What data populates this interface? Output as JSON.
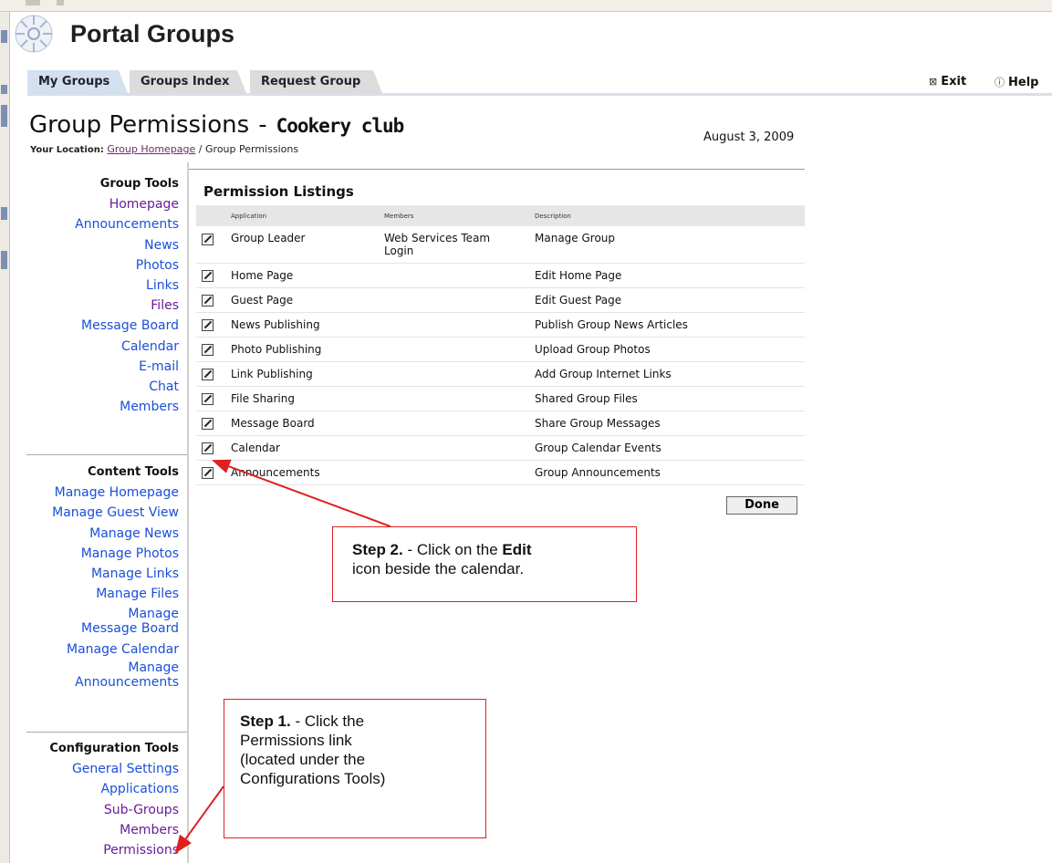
{
  "app": {
    "title": "Portal Groups"
  },
  "tabs": [
    {
      "label": "My Groups"
    },
    {
      "label": "Groups Index"
    },
    {
      "label": "Request Group"
    }
  ],
  "top_links": {
    "exit": "Exit",
    "help": "Help"
  },
  "page": {
    "title": "Group Permissions",
    "separator": "-",
    "group_name": "Cookery club",
    "location_label": "Your Location:",
    "location_link": "Group Homepage",
    "location_sep": "/",
    "location_current": "Group Permissions",
    "date": "August 3, 2009"
  },
  "sidebar": {
    "group_tools": {
      "heading": "Group Tools",
      "items": [
        "Homepage",
        "Announcements",
        "News",
        "Photos",
        "Links",
        "Files",
        "Message Board",
        "Calendar",
        "E-mail",
        "Chat",
        "Members"
      ]
    },
    "content_tools": {
      "heading": "Content Tools",
      "items": [
        "Manage Homepage",
        "Manage Guest View",
        "Manage News",
        "Manage Photos",
        "Manage Links",
        "Manage Files",
        "Manage",
        "Message Board",
        "Manage Calendar",
        "Manage",
        "Announcements"
      ]
    },
    "config_tools": {
      "heading": "Configuration Tools",
      "items": [
        "General Settings",
        "Applications",
        "Sub-Groups",
        "Members",
        "Permissions"
      ]
    }
  },
  "listing": {
    "heading": "Permission Listings",
    "columns": [
      "Application",
      "Members",
      "Description"
    ],
    "rows": [
      {
        "application": "Group Leader",
        "members": "Web Services Team",
        "members2": "Login",
        "description": "Manage Group"
      },
      {
        "application": "Home Page",
        "members": "",
        "description": "Edit Home Page"
      },
      {
        "application": "Guest Page",
        "members": "",
        "description": "Edit Guest Page"
      },
      {
        "application": "News Publishing",
        "members": "",
        "description": "Publish Group News Articles"
      },
      {
        "application": "Photo Publishing",
        "members": "",
        "description": "Upload Group Photos"
      },
      {
        "application": "Link Publishing",
        "members": "",
        "description": "Add Group Internet Links"
      },
      {
        "application": "File Sharing",
        "members": "",
        "description": "Shared Group Files"
      },
      {
        "application": "Message Board",
        "members": "",
        "description": "Share Group Messages"
      },
      {
        "application": "Calendar",
        "members": "",
        "description": "Group Calendar Events"
      },
      {
        "application": "Announcements",
        "members": "",
        "description": "Group Announcements"
      }
    ],
    "done_label": "Done"
  },
  "callouts": {
    "step2": {
      "step": "Step 2.",
      "pre": " - Click on the ",
      "bold": "Edit",
      "post": "icon beside the calendar."
    },
    "step1": {
      "step": "Step 1.",
      "pre": " - Click the",
      "lines": [
        "Permissions link",
        "(located under the",
        "Configurations Tools)"
      ]
    }
  },
  "colors": {
    "callout_border": "#e02020",
    "link": "#1a4fd8",
    "visited_link": "#6a1b9a",
    "active_tab": "#d3e0ef"
  }
}
